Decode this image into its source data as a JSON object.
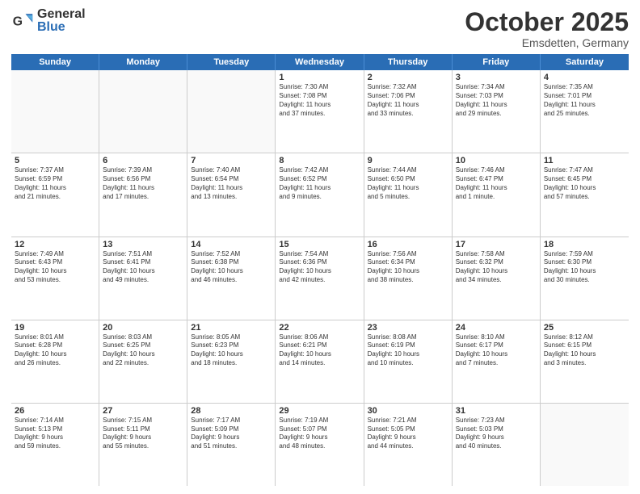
{
  "header": {
    "logo_general": "General",
    "logo_blue": "Blue",
    "month": "October 2025",
    "location": "Emsdetten, Germany"
  },
  "weekdays": [
    "Sunday",
    "Monday",
    "Tuesday",
    "Wednesday",
    "Thursday",
    "Friday",
    "Saturday"
  ],
  "rows": [
    [
      {
        "day": "",
        "text": ""
      },
      {
        "day": "",
        "text": ""
      },
      {
        "day": "",
        "text": ""
      },
      {
        "day": "1",
        "text": "Sunrise: 7:30 AM\nSunset: 7:08 PM\nDaylight: 11 hours\nand 37 minutes."
      },
      {
        "day": "2",
        "text": "Sunrise: 7:32 AM\nSunset: 7:06 PM\nDaylight: 11 hours\nand 33 minutes."
      },
      {
        "day": "3",
        "text": "Sunrise: 7:34 AM\nSunset: 7:03 PM\nDaylight: 11 hours\nand 29 minutes."
      },
      {
        "day": "4",
        "text": "Sunrise: 7:35 AM\nSunset: 7:01 PM\nDaylight: 11 hours\nand 25 minutes."
      }
    ],
    [
      {
        "day": "5",
        "text": "Sunrise: 7:37 AM\nSunset: 6:59 PM\nDaylight: 11 hours\nand 21 minutes."
      },
      {
        "day": "6",
        "text": "Sunrise: 7:39 AM\nSunset: 6:56 PM\nDaylight: 11 hours\nand 17 minutes."
      },
      {
        "day": "7",
        "text": "Sunrise: 7:40 AM\nSunset: 6:54 PM\nDaylight: 11 hours\nand 13 minutes."
      },
      {
        "day": "8",
        "text": "Sunrise: 7:42 AM\nSunset: 6:52 PM\nDaylight: 11 hours\nand 9 minutes."
      },
      {
        "day": "9",
        "text": "Sunrise: 7:44 AM\nSunset: 6:50 PM\nDaylight: 11 hours\nand 5 minutes."
      },
      {
        "day": "10",
        "text": "Sunrise: 7:46 AM\nSunset: 6:47 PM\nDaylight: 11 hours\nand 1 minute."
      },
      {
        "day": "11",
        "text": "Sunrise: 7:47 AM\nSunset: 6:45 PM\nDaylight: 10 hours\nand 57 minutes."
      }
    ],
    [
      {
        "day": "12",
        "text": "Sunrise: 7:49 AM\nSunset: 6:43 PM\nDaylight: 10 hours\nand 53 minutes."
      },
      {
        "day": "13",
        "text": "Sunrise: 7:51 AM\nSunset: 6:41 PM\nDaylight: 10 hours\nand 49 minutes."
      },
      {
        "day": "14",
        "text": "Sunrise: 7:52 AM\nSunset: 6:38 PM\nDaylight: 10 hours\nand 46 minutes."
      },
      {
        "day": "15",
        "text": "Sunrise: 7:54 AM\nSunset: 6:36 PM\nDaylight: 10 hours\nand 42 minutes."
      },
      {
        "day": "16",
        "text": "Sunrise: 7:56 AM\nSunset: 6:34 PM\nDaylight: 10 hours\nand 38 minutes."
      },
      {
        "day": "17",
        "text": "Sunrise: 7:58 AM\nSunset: 6:32 PM\nDaylight: 10 hours\nand 34 minutes."
      },
      {
        "day": "18",
        "text": "Sunrise: 7:59 AM\nSunset: 6:30 PM\nDaylight: 10 hours\nand 30 minutes."
      }
    ],
    [
      {
        "day": "19",
        "text": "Sunrise: 8:01 AM\nSunset: 6:28 PM\nDaylight: 10 hours\nand 26 minutes."
      },
      {
        "day": "20",
        "text": "Sunrise: 8:03 AM\nSunset: 6:25 PM\nDaylight: 10 hours\nand 22 minutes."
      },
      {
        "day": "21",
        "text": "Sunrise: 8:05 AM\nSunset: 6:23 PM\nDaylight: 10 hours\nand 18 minutes."
      },
      {
        "day": "22",
        "text": "Sunrise: 8:06 AM\nSunset: 6:21 PM\nDaylight: 10 hours\nand 14 minutes."
      },
      {
        "day": "23",
        "text": "Sunrise: 8:08 AM\nSunset: 6:19 PM\nDaylight: 10 hours\nand 10 minutes."
      },
      {
        "day": "24",
        "text": "Sunrise: 8:10 AM\nSunset: 6:17 PM\nDaylight: 10 hours\nand 7 minutes."
      },
      {
        "day": "25",
        "text": "Sunrise: 8:12 AM\nSunset: 6:15 PM\nDaylight: 10 hours\nand 3 minutes."
      }
    ],
    [
      {
        "day": "26",
        "text": "Sunrise: 7:14 AM\nSunset: 5:13 PM\nDaylight: 9 hours\nand 59 minutes."
      },
      {
        "day": "27",
        "text": "Sunrise: 7:15 AM\nSunset: 5:11 PM\nDaylight: 9 hours\nand 55 minutes."
      },
      {
        "day": "28",
        "text": "Sunrise: 7:17 AM\nSunset: 5:09 PM\nDaylight: 9 hours\nand 51 minutes."
      },
      {
        "day": "29",
        "text": "Sunrise: 7:19 AM\nSunset: 5:07 PM\nDaylight: 9 hours\nand 48 minutes."
      },
      {
        "day": "30",
        "text": "Sunrise: 7:21 AM\nSunset: 5:05 PM\nDaylight: 9 hours\nand 44 minutes."
      },
      {
        "day": "31",
        "text": "Sunrise: 7:23 AM\nSunset: 5:03 PM\nDaylight: 9 hours\nand 40 minutes."
      },
      {
        "day": "",
        "text": ""
      }
    ]
  ]
}
